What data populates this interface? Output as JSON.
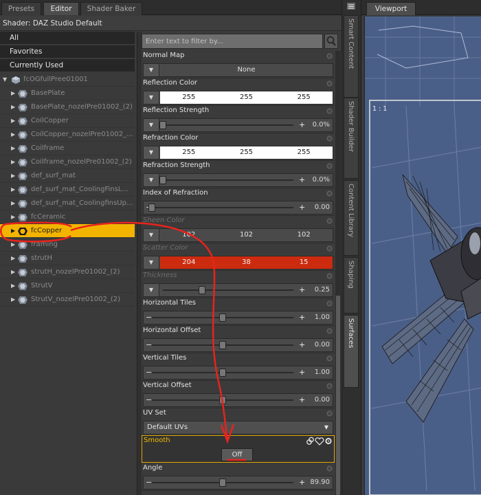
{
  "tabs": [
    {
      "label": "Presets",
      "active": false
    },
    {
      "label": "Editor",
      "active": true
    },
    {
      "label": "Shader Baker",
      "active": false
    }
  ],
  "shader_label": "Shader: DAZ Studio Default",
  "tree": {
    "favorites": [
      "All",
      "Favorites",
      "Currently Used"
    ],
    "root": "fcOGfullPree01001",
    "items": [
      "BasePlate",
      "BasePlate_nozelPre01002_(2)",
      "CoilCopper",
      "CoilCopper_nozelPre01002_...",
      "Coilframe",
      "Coilframe_nozelPre01002_(2)",
      "def_surf_mat",
      "def_surf_mat_CoolingFinsL...",
      "def_surf_mat_CoolingfinsUp...",
      "fcCeramic",
      "fcCopper",
      "framing",
      "strutH",
      "strutH_nozelPre01002_(2)",
      "StrutV",
      "StrutV_nozelPre01002_(2)"
    ],
    "selected": "fcCopper"
  },
  "filter": {
    "placeholder": "Enter text to filter by..."
  },
  "properties": {
    "normal_map": {
      "label": "Normal Map",
      "value": "None"
    },
    "reflection_color": {
      "label": "Reflection Color",
      "r": "255",
      "g": "255",
      "b": "255"
    },
    "reflection_strength": {
      "label": "Reflection Strength",
      "value": "0.0%",
      "level": 0.0
    },
    "refraction_color": {
      "label": "Refraction Color",
      "r": "255",
      "g": "255",
      "b": "255"
    },
    "refraction_strength": {
      "label": "Refraction Strength",
      "value": "0.0%",
      "level": 0.0
    },
    "index_of_refraction": {
      "label": "Index of Refraction",
      "value": "0.00",
      "level": 0.0
    },
    "sheen_color": {
      "label": "Sheen Color",
      "r": "102",
      "g": "102",
      "b": "102"
    },
    "scatter_color": {
      "label": "Scatter Color",
      "r": "204",
      "g": "38",
      "b": "15",
      "hex": "#cc260f"
    },
    "thickness": {
      "label": "Thickness",
      "value": "0.25",
      "level": 0.3
    },
    "horizontal_tiles": {
      "label": "Horizontal Tiles",
      "value": "1.00",
      "level": 0.5
    },
    "horizontal_offset": {
      "label": "Horizontal Offset",
      "value": "0.00",
      "level": 0.5
    },
    "vertical_tiles": {
      "label": "Vertical Tiles",
      "value": "1.00",
      "level": 0.5
    },
    "vertical_offset": {
      "label": "Vertical Offset",
      "value": "0.00",
      "level": 0.5
    },
    "uv_set": {
      "label": "UV Set",
      "value": "Default UVs"
    },
    "smooth": {
      "label": "Smooth",
      "value": "Off"
    },
    "angle": {
      "label": "Angle",
      "value": "89.90",
      "level": 0.5
    }
  },
  "side_tabs": [
    "Smart Content",
    "Shader Builder",
    "Content Library",
    "Shaping",
    "Surfaces"
  ],
  "active_side_tab": "Surfaces",
  "viewport": {
    "tab": "Viewport",
    "ratio": "1 : 1"
  },
  "colors": {
    "selection": "#f3b400",
    "annotation": "#e8231d",
    "viewport_bg": "#4a5f88",
    "scatter": "#cc260f"
  }
}
